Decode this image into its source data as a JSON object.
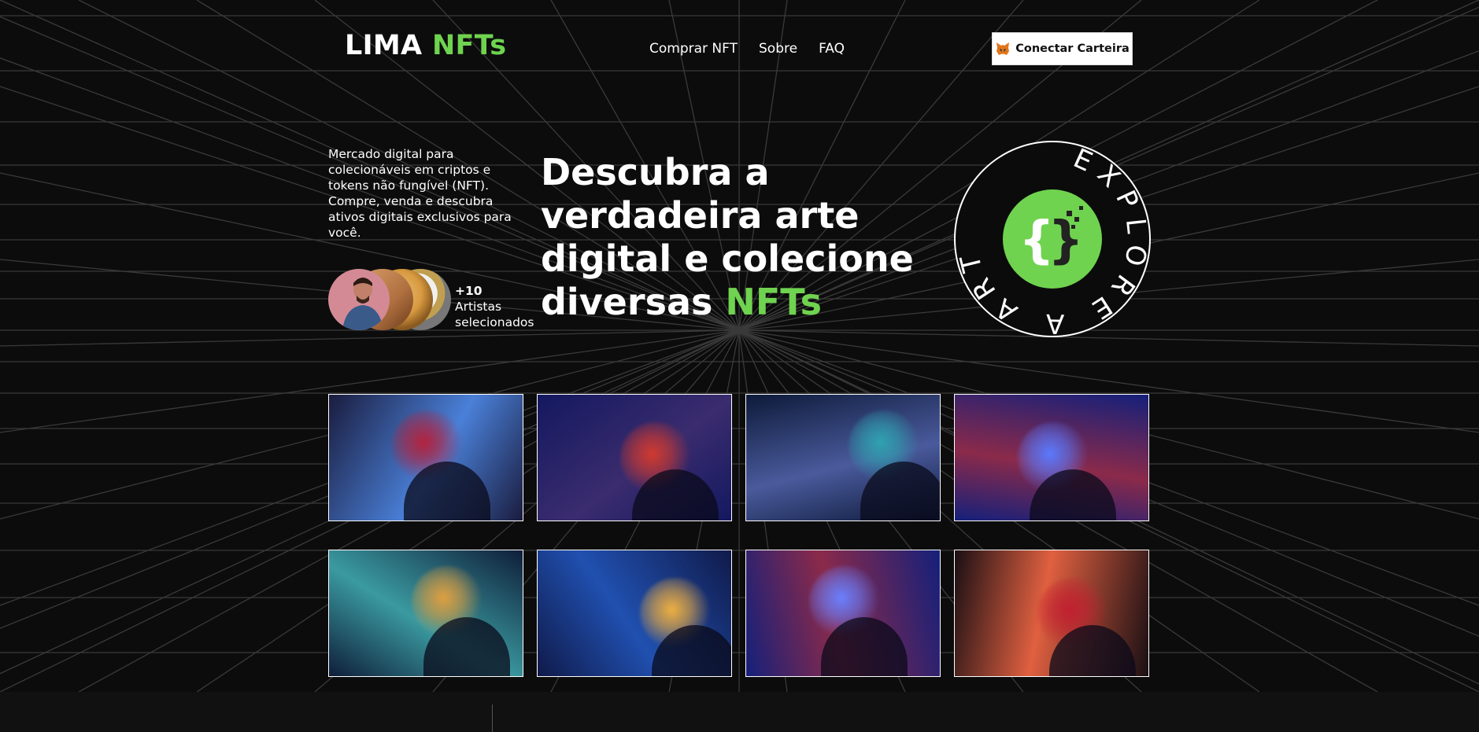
{
  "colors": {
    "accent": "#6fd34f",
    "background": "#0b0b0b",
    "grid": "#3a3a3a"
  },
  "header": {
    "logo_main": "LIMA",
    "logo_accent": "NFTs",
    "nav": [
      "Comprar NFT",
      "Sobre",
      "FAQ"
    ],
    "wallet_button": {
      "label": "Conectar Carteira",
      "icon": "metamask-fox-icon"
    }
  },
  "hero": {
    "intro": "Mercado digital para colecionáveis em criptos e tokens não fungível (NFT). Compre, venda e descubra ativos digitais exclusivos para você.",
    "headline_lines": [
      "Descubra a",
      "verdadeira arte",
      "digital e colecione",
      "diversas"
    ],
    "headline_accent": "NFTs",
    "artists_count": "+10",
    "artists_label_1": "Artistas",
    "artists_label_2": "selecionados",
    "badge_text": "EXPLORE A ARTE",
    "badge_icon": "code-braces-icon"
  },
  "gallery": {
    "items": [
      {
        "name": "nft-1",
        "colors": [
          "#1a1c3e",
          "#b3223c",
          "#4a80d8"
        ]
      },
      {
        "name": "nft-2",
        "colors": [
          "#141860",
          "#d23a2f",
          "#3a2c6e"
        ]
      },
      {
        "name": "nft-3",
        "colors": [
          "#0d1a3a",
          "#2fa3b0",
          "#4a5a9c"
        ]
      },
      {
        "name": "nft-4",
        "colors": [
          "#15207a",
          "#5a7aff",
          "#8b2a4a"
        ]
      },
      {
        "name": "nft-5",
        "colors": [
          "#0f1e3a",
          "#e0a040",
          "#3a9aa0"
        ]
      },
      {
        "name": "nft-6",
        "colors": [
          "#101a4a",
          "#f0b040",
          "#2050b0"
        ]
      },
      {
        "name": "nft-7",
        "colors": [
          "#15207a",
          "#6a80ff",
          "#8b2a4a"
        ]
      },
      {
        "name": "nft-8",
        "colors": [
          "#1a0f14",
          "#c02030",
          "#e06040"
        ]
      }
    ]
  }
}
